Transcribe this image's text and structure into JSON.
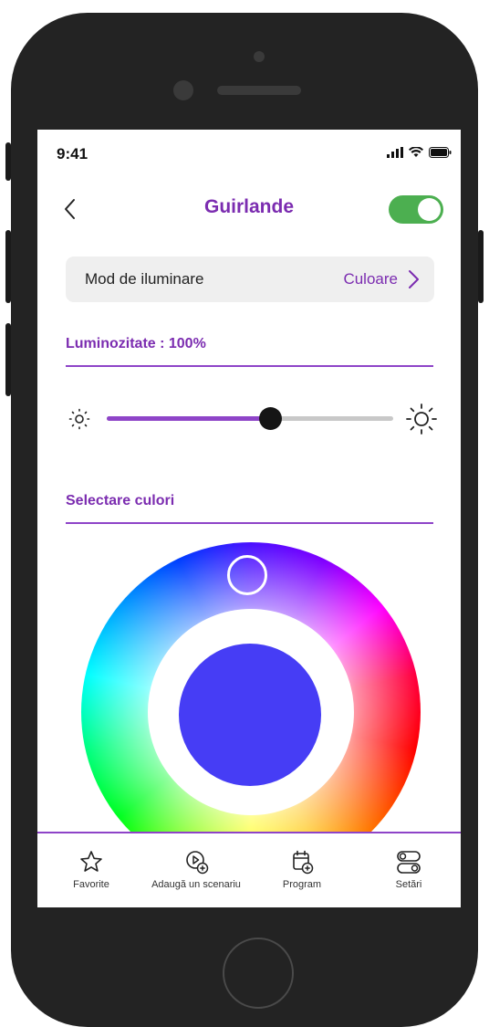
{
  "status_bar": {
    "time": "9:41",
    "icons": [
      "signal-icon",
      "wifi-icon",
      "battery-icon"
    ]
  },
  "header": {
    "title": "Guirlande",
    "back_icon": "chevron-left-icon",
    "power_toggle_on": true
  },
  "lighting_mode": {
    "label": "Mod de iluminare",
    "value": "Culoare",
    "icon": "chevron-right-icon"
  },
  "brightness": {
    "title": "Luminozitate : 100%",
    "slider_value": 0.57,
    "min_icon": "sun-small-icon",
    "max_icon": "sun-large-icon"
  },
  "color_selection": {
    "title": "Selectare culori",
    "selected_color": "#463df5"
  },
  "bottom_nav": {
    "items": [
      {
        "label": "Favorite",
        "icon": "star-icon"
      },
      {
        "label": "Adaugă un scenariu",
        "icon": "add-scenario-icon"
      },
      {
        "label": "Program",
        "icon": "calendar-add-icon"
      },
      {
        "label": "Setări",
        "icon": "settings-toggles-icon"
      }
    ]
  },
  "colors": {
    "accent": "#7b2cb0",
    "toggle_on": "#4caf50",
    "frame": "#232323"
  }
}
